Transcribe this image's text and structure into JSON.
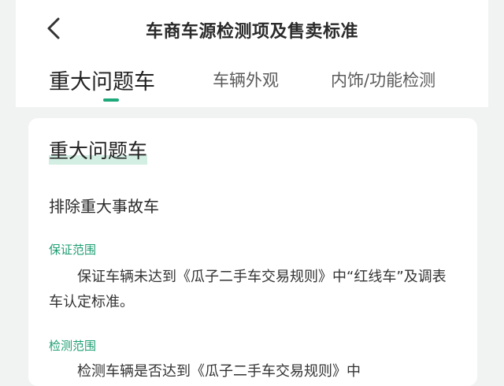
{
  "header": {
    "title": "车商车源检测项及售卖标准",
    "back_icon": "chevron-left-icon"
  },
  "tabs": [
    {
      "label": "重大问题车",
      "active": true
    },
    {
      "label": "车辆外观",
      "active": false
    },
    {
      "label": "内饰/功能检测",
      "active": false
    }
  ],
  "card": {
    "title": "重大问题车",
    "subtitle": "排除重大事故车",
    "sections": [
      {
        "label": "保证范围",
        "text": "保证车辆未达到《瓜子二手车交易规则》中“红线车”及调表车认定标准。"
      },
      {
        "label": "检测范围",
        "text": "检测车辆是否达到《瓜子二手车交易规则》中"
      }
    ]
  },
  "colors": {
    "accent": "#1ea97a",
    "label_green": "#1f9e73",
    "title_highlight": "#d3eee3",
    "background": "#f1f3f2"
  }
}
